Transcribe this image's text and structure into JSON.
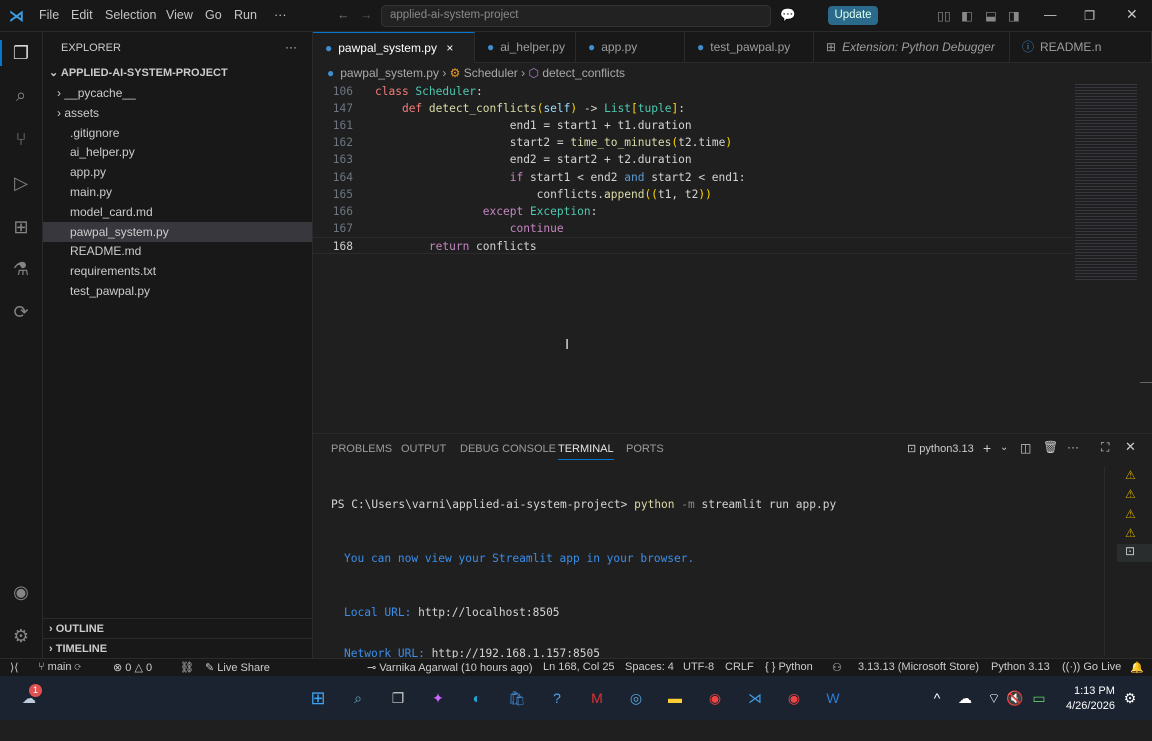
{
  "titlebar": {
    "menu": [
      "File",
      "Edit",
      "Selection",
      "View",
      "Go",
      "Run",
      "···"
    ],
    "search": "applied-ai-system-project",
    "update": "Update"
  },
  "sidebar": {
    "title": "EXPLORER",
    "more": "···",
    "project": "APPLIED-AI-SYSTEM-PROJECT",
    "items": [
      {
        "label": "__pycache__",
        "folder": true
      },
      {
        "label": "assets",
        "folder": true
      },
      {
        "label": ".gitignore"
      },
      {
        "label": "ai_helper.py"
      },
      {
        "label": "app.py"
      },
      {
        "label": "main.py"
      },
      {
        "label": "model_card.md"
      },
      {
        "label": "pawpal_system.py",
        "selected": true
      },
      {
        "label": "README.md"
      },
      {
        "label": "requirements.txt"
      },
      {
        "label": "test_pawpal.py"
      }
    ],
    "outline": "OUTLINE",
    "timeline": "TIMELINE"
  },
  "tabs": [
    {
      "label": "pawpal_system.py",
      "active": true,
      "close": "×"
    },
    {
      "label": "ai_helper.py"
    },
    {
      "label": "app.py"
    },
    {
      "label": "test_pawpal.py"
    },
    {
      "label": "Extension: Python Debugger",
      "italic": true
    },
    {
      "label": "README.n"
    }
  ],
  "breadcrumb": [
    "pawpal_system.py",
    "Scheduler",
    "detect_conflicts"
  ],
  "code": [
    {
      "n": "106",
      "indent": 0,
      "t": [
        [
          "class ",
          "kw2"
        ],
        [
          "Scheduler",
          "cls"
        ],
        [
          ":",
          "plain"
        ]
      ]
    },
    {
      "n": "147",
      "indent": 4,
      "t": [
        [
          "def ",
          "kw2"
        ],
        [
          "detect_conflicts",
          "fn"
        ],
        [
          "(",
          "br"
        ],
        [
          "self",
          "var"
        ],
        [
          ")",
          "br"
        ],
        [
          " -> ",
          "plain"
        ],
        [
          "List",
          "cls"
        ],
        [
          "[",
          "br"
        ],
        [
          "tuple",
          "cls"
        ],
        [
          "]",
          "br"
        ],
        [
          ":",
          "plain"
        ]
      ]
    },
    {
      "n": "161",
      "indent": 20,
      "t": [
        [
          "end1 = start1 + t1.duration",
          "plain"
        ]
      ]
    },
    {
      "n": "162",
      "indent": 20,
      "t": [
        [
          "start2",
          "plain"
        ],
        [
          " = ",
          "plain"
        ],
        [
          "time_to_minutes",
          "fn"
        ],
        [
          "(",
          "br"
        ],
        [
          "t2.time",
          "plain"
        ],
        [
          ")",
          "br"
        ]
      ]
    },
    {
      "n": "163",
      "indent": 20,
      "t": [
        [
          "end2 = start2 + t2.duration",
          "plain"
        ]
      ]
    },
    {
      "n": "164",
      "indent": 20,
      "t": [
        [
          "if ",
          "kw"
        ],
        [
          "start1 < end2 ",
          "plain"
        ],
        [
          "and ",
          "bl"
        ],
        [
          "start2 < end1:",
          "plain"
        ]
      ]
    },
    {
      "n": "165",
      "indent": 24,
      "t": [
        [
          "conflicts.",
          "plain"
        ],
        [
          "append",
          "fn"
        ],
        [
          "((",
          "br"
        ],
        [
          "t1, t2",
          "plain"
        ],
        [
          "))",
          "br"
        ]
      ]
    },
    {
      "n": "166",
      "indent": 16,
      "t": [
        [
          "except ",
          "kw"
        ],
        [
          "Exception",
          "cls"
        ],
        [
          ":",
          "plain"
        ]
      ]
    },
    {
      "n": "167",
      "indent": 20,
      "t": [
        [
          "continue",
          "kw"
        ]
      ]
    },
    {
      "n": "168",
      "indent": 8,
      "current": true,
      "t": [
        [
          "return ",
          "kw"
        ],
        [
          "conflicts",
          "plain"
        ]
      ]
    }
  ],
  "panel": {
    "tabs": [
      "PROBLEMS",
      "OUTPUT",
      "DEBUG CONSOLE",
      "TERMINAL",
      "PORTS"
    ],
    "active": "TERMINAL",
    "shell": "python3.13",
    "terminal": {
      "prompt": "PS C:\\Users\\varni\\applied-ai-system-project> ",
      "cmd": "python",
      "flag": " -m",
      "args": " streamlit run app.py",
      "msg": "You can now view your Streamlit app in your browser.",
      "local_label": "Local URL: ",
      "local_url": "http://localhost:8505",
      "net_label": "Network URL: ",
      "net_url": "http://192.168.1.157:8505"
    }
  },
  "status": {
    "branch": "main",
    "errors": "0",
    "warnings": "0",
    "liveshare": "Live Share",
    "blame": "Varnika Agarwal (10 hours ago)",
    "cursor": "Ln 168, Col 25",
    "spaces": "Spaces: 4",
    "encoding": "UTF-8",
    "eol": "CRLF",
    "lang": "Python",
    "interp": "3.13.13 (Microsoft Store)",
    "pyver": "Python 3.13",
    "golive": "Go Live"
  },
  "taskbar": {
    "time": "1:13 PM",
    "date": "4/26/2026",
    "badge": "1"
  },
  "colors": {
    "accent": "#0078d4",
    "update": "#2c6a8c"
  }
}
